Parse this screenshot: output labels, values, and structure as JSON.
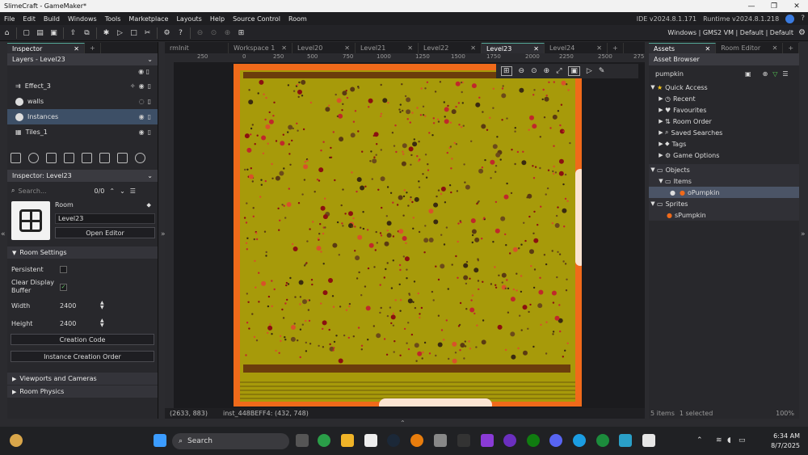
{
  "app": {
    "title": "SlimeCraft - GameMaker*",
    "version_ide": "IDE v2024.8.1.171",
    "version_runtime": "Runtime v2024.8.1.218"
  },
  "menu": [
    "File",
    "Edit",
    "Build",
    "Windows",
    "Tools",
    "Marketplace",
    "Layouts",
    "Help",
    "Source Control",
    "Room"
  ],
  "toolbar": {
    "target": "Windows | GMS2 VM | Default | Default"
  },
  "left": {
    "tab": "Inspector",
    "layers_header": "Layers - Level23",
    "layers": [
      {
        "name": "Effect_3"
      },
      {
        "name": "walls"
      },
      {
        "name": "Instances"
      },
      {
        "name": "Tiles_1"
      }
    ],
    "inspector_header": "Inspector: Level23",
    "search_placeholder": "Search...",
    "search_count": "0/0",
    "room_label": "Room",
    "room_name": "Level23",
    "open_editor": "Open Editor",
    "room_settings": "Room Settings",
    "persistent": "Persistent",
    "clear_display": "Clear Display Buffer",
    "width_label": "Width",
    "width": "2400",
    "height_label": "Height",
    "height": "2400",
    "creation_code": "Creation Code",
    "instance_order": "Instance Creation Order",
    "viewports": "Viewports and Cameras",
    "physics": "Room Physics"
  },
  "doc_tabs": [
    "rmInit",
    "Workspace 1",
    "Level20",
    "Level21",
    "Level22",
    "Level23",
    "Level24"
  ],
  "ruler": [
    "250",
    "0",
    "250",
    "500",
    "750",
    "1000",
    "1250",
    "1500",
    "1750",
    "2000",
    "2250",
    "2500",
    "275"
  ],
  "status": {
    "coords": "(2633, 883)",
    "instance": "inst_448BEFF4: (432, 748)"
  },
  "right": {
    "tab1": "Assets",
    "tab2": "Room Editor",
    "browser": "Asset Browser",
    "search": "pumpkin",
    "tree": [
      {
        "label": "Quick Access",
        "level": 0
      },
      {
        "label": "Recent",
        "level": 1
      },
      {
        "label": "Favourites",
        "level": 1
      },
      {
        "label": "Room Order",
        "level": 1
      },
      {
        "label": "Saved Searches",
        "level": 1
      },
      {
        "label": "Tags",
        "level": 1
      },
      {
        "label": "Game Options",
        "level": 1
      },
      {
        "label": "Objects",
        "level": 0
      },
      {
        "label": "Items",
        "level": 1
      },
      {
        "label": "oPumpkin",
        "level": 2
      },
      {
        "label": "Sprites",
        "level": 0
      },
      {
        "label": "sPumpkin",
        "level": 1
      }
    ],
    "footer_items": "5 items",
    "footer_selected": "1 selected",
    "zoom": "100%"
  },
  "taskbar": {
    "search": "Search",
    "time": "6:34 AM",
    "date": "8/7/2025"
  },
  "colors": {
    "room_bg": "#a79a0a",
    "border": "#f06a1a",
    "accent": "#5a9"
  }
}
